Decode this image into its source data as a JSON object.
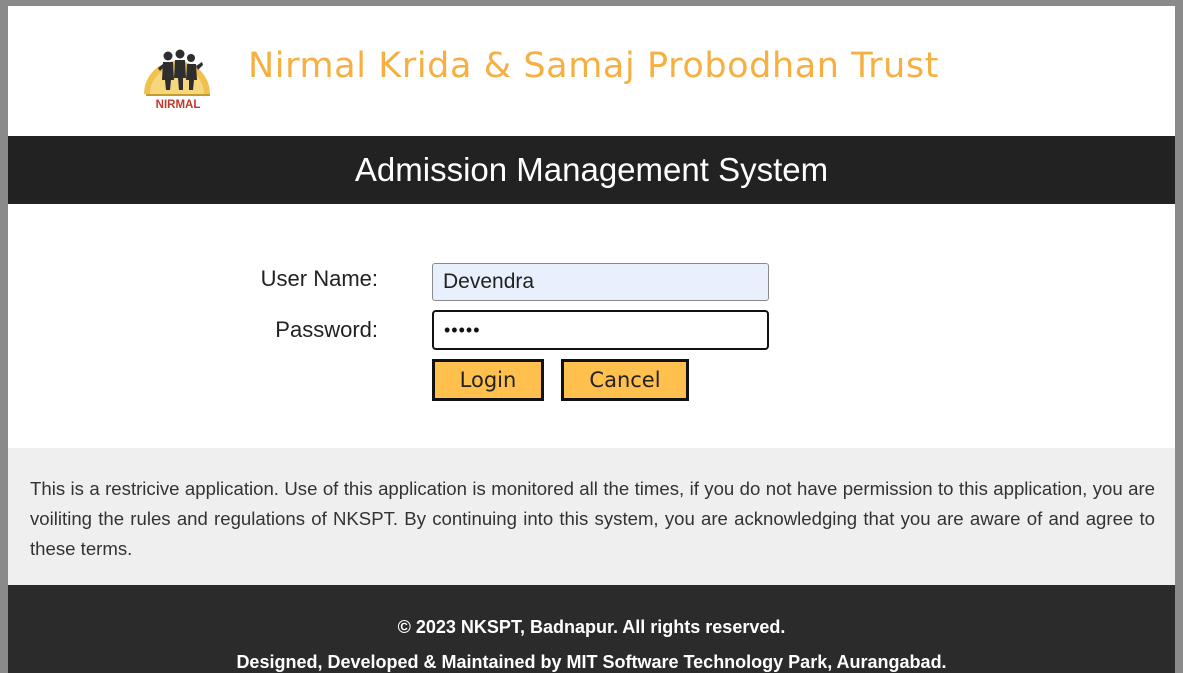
{
  "header": {
    "logo_text": "NIRMAL",
    "org_name": "Nirmal Krida & Samaj Probodhan Trust"
  },
  "title_bar": {
    "title": "Admission Management System"
  },
  "login_form": {
    "username_label": "User Name:",
    "username_value": "Devendra",
    "password_label": "Password:",
    "password_value": "•••••",
    "login_button": "Login",
    "cancel_button": "Cancel"
  },
  "notice": {
    "text": "This is a restricive application. Use of this application is monitored all the times, if you do not have permission to this application, you are voiliting the rules and regulations of NKSPT. By continuing into this system, you are acknowledging that you are aware of and agree to these terms."
  },
  "footer": {
    "copyright": "© 2023 NKSPT, Badnapur. All rights reserved.",
    "credits": "Designed, Developed & Maintained by MIT Software Technology Park, Aurangabad."
  },
  "colors": {
    "org_name": "#f5b041",
    "title_bar_bg": "#222222",
    "username_field_bg": "#e8f0fe",
    "button_bg": "#ffc04d",
    "notice_bg": "#efefef",
    "footer_bg": "#2b2b2b"
  },
  "icons": {
    "logo": "nirmal-logo-icon"
  }
}
